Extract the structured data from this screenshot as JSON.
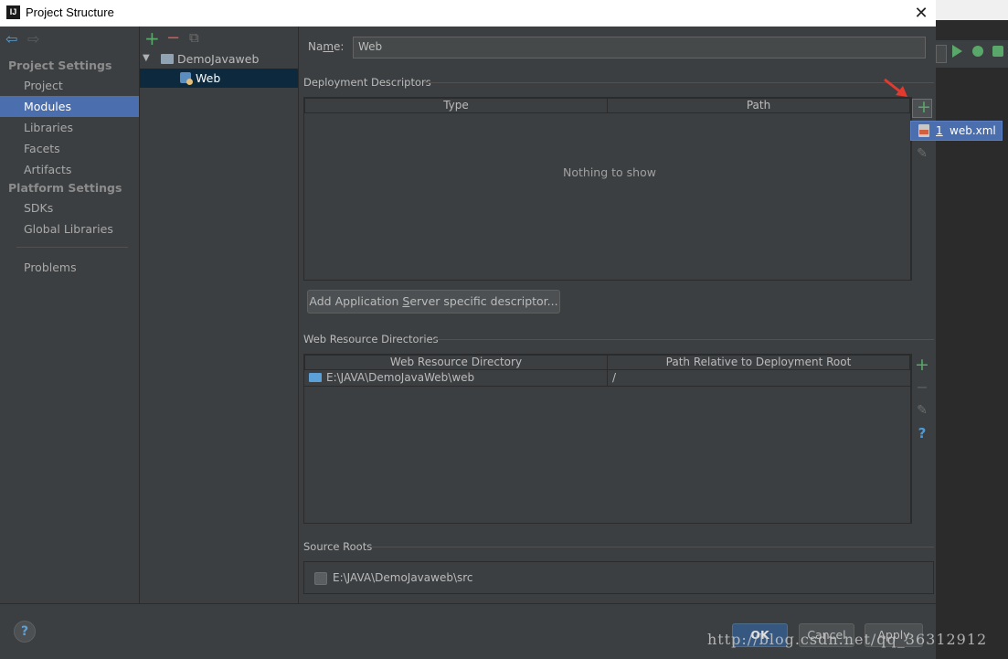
{
  "window": {
    "title": "Project Structure",
    "app_icon": "intellij-icon",
    "close_glyph": "✕"
  },
  "nav": {
    "back_glyph": "⇦",
    "forward_glyph": "⇨",
    "project_settings_header": "Project Settings",
    "project_settings": [
      "Project",
      "Modules",
      "Libraries",
      "Facets",
      "Artifacts"
    ],
    "platform_settings_header": "Platform Settings",
    "platform_settings": [
      "SDKs",
      "Global Libraries"
    ],
    "problems": "Problems",
    "selected": "Modules"
  },
  "tree": {
    "add_glyph": "+",
    "remove_glyph": "−",
    "copy_glyph": "⧉",
    "expand_glyph": "▼",
    "root": "DemoJavaweb",
    "child": "Web"
  },
  "main": {
    "name_label_pre": "Na",
    "name_label_u": "m",
    "name_label_post": "e:",
    "name_value": "Web",
    "deployment_descriptors_title": "Deployment Descriptors",
    "dd_columns": [
      "Type",
      "Path"
    ],
    "dd_empty": "Nothing to show",
    "add_glyph": "+",
    "edit_glyph": "✎",
    "popup_number": "1",
    "popup_label": "web.xml",
    "add_server_pre": "Add Application ",
    "add_server_u": "S",
    "add_server_post": "erver specific descriptor...",
    "web_resource_title": "Web Resource Directories",
    "wr_columns": [
      "Web Resource Directory",
      "Path Relative to Deployment Root"
    ],
    "wr_row": {
      "dir": "E:\\JAVA\\DemoJavaWeb\\web",
      "rel": "/"
    },
    "wr_minus_glyph": "−",
    "wr_help_glyph": "?",
    "source_roots_title": "Source Roots",
    "source_root": "E:\\JAVA\\DemoJavaweb\\src"
  },
  "footer": {
    "help_glyph": "?",
    "ok": "OK",
    "cancel": "Cancel",
    "apply": "Apply"
  },
  "watermark": "http://blog.csdn.net/qq_36312912",
  "colors": {
    "accent": "#4b6eaf",
    "green": "#59a869",
    "red": "#e05555",
    "bg": "#3c3f41"
  }
}
